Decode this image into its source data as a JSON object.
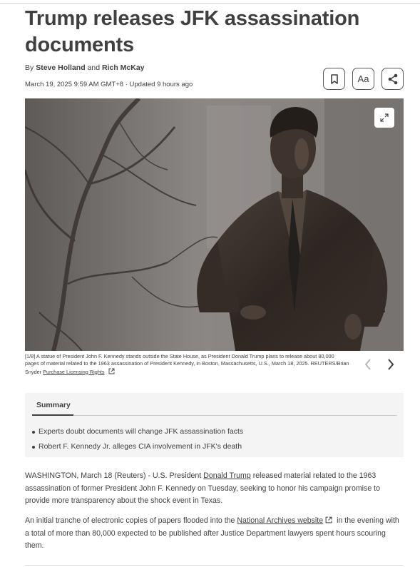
{
  "headline": "Trump releases JFK assassination documents",
  "byline": {
    "prefix": "By",
    "author1": "Steve Holland",
    "conjunction": "and",
    "author2": "Rich McKay"
  },
  "dateline": "March 19, 2025 9:59 AM GMT+8 · Updated 9 hours ago",
  "tools": {
    "bookmark_icon": "bookmark-icon",
    "text_size_label": "Aa",
    "share_icon": "share-icon"
  },
  "photo": {
    "subject": "bronze statue of John F. Kennedy",
    "expand_icon": "expand-icon"
  },
  "caption": {
    "text": "[1/8] A statue of President John F. Kennedy stands outside the State House, as President Donald Trump plans to release about 80,000 pages of material related to the 1963 assassination of President Kennedy, in Boston, Massachusetts, U.S., March 18, 2025. REUTERS/Brian Snyder",
    "link": "Purchase Licensing Rights"
  },
  "summary": {
    "tab": "Summary",
    "items": [
      "Experts doubt documents will change JFK assassination facts",
      "Robert F. Kennedy Jr. alleges CIA involvement in JFK's death"
    ]
  },
  "article": {
    "p1_before": "WASHINGTON, March 18 (Reuters) - U.S. President ",
    "p1_link": "Donald Trump",
    "p1_after": " released material related to the 1963 assassination of former President John F. Kennedy on Tuesday, seeking to honor his campaign promise to provide more transparency about the shock event in Texas.",
    "p2_before": "An initial tranche of electronic copies of papers flooded into the ",
    "p2_link": "National Archives website",
    "p2_after": " in the evening with a total of more than 80,000 expected to be published after Justice Department lawyers spent hours scouring them."
  },
  "colors": {
    "text": "#404040",
    "summary_bg": "#f4f4f4"
  }
}
